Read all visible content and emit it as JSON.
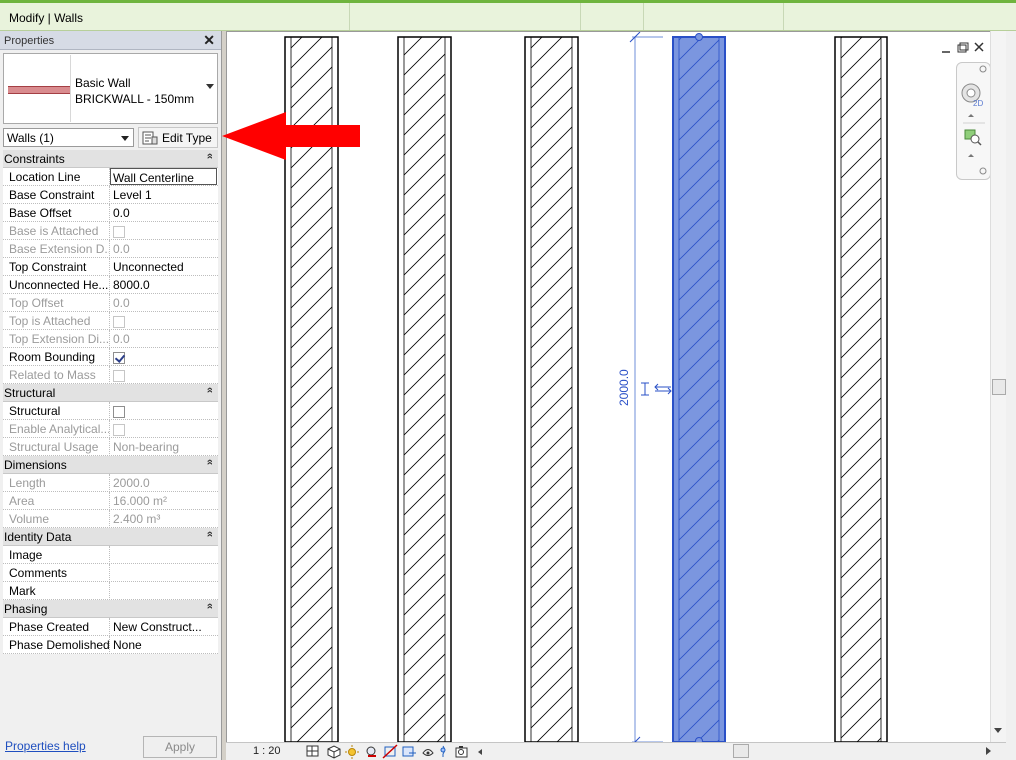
{
  "context_bar": {
    "title": "Modify | Walls"
  },
  "properties": {
    "header": "Properties",
    "close_glyph": "✕",
    "type_selector": {
      "family": "Basic Wall",
      "type": "BRICKWALL - 150mm",
      "swatch_color": "#d98c8f"
    },
    "filter": {
      "value": "Walls (1)"
    },
    "edit_type_label": "Edit Type",
    "collapse_glyph": "»",
    "groups": [
      {
        "name": "Constraints",
        "rows": [
          {
            "key": "Location Line",
            "value": "Wall Centerline",
            "editing": true
          },
          {
            "key": "Base Constraint",
            "value": "Level 1"
          },
          {
            "key": "Base Offset",
            "value": "0.0"
          },
          {
            "key": "Base is Attached",
            "checkbox": false,
            "disabled": true
          },
          {
            "key": "Base Extension D...",
            "value": "0.0",
            "disabled": true
          },
          {
            "key": "Top Constraint",
            "value": "Unconnected"
          },
          {
            "key": "Unconnected He...",
            "value": "8000.0"
          },
          {
            "key": "Top Offset",
            "value": "0.0",
            "disabled": true
          },
          {
            "key": "Top is Attached",
            "checkbox": false,
            "disabled": true
          },
          {
            "key": "Top Extension Di...",
            "value": "0.0",
            "disabled": true
          },
          {
            "key": "Room Bounding",
            "checkbox": true
          },
          {
            "key": "Related to Mass",
            "checkbox": false,
            "disabled": true
          }
        ]
      },
      {
        "name": "Structural",
        "rows": [
          {
            "key": "Structural",
            "checkbox": false
          },
          {
            "key": "Enable Analytical...",
            "checkbox": false,
            "disabled": true
          },
          {
            "key": "Structural Usage",
            "value": "Non-bearing",
            "disabled": true
          }
        ]
      },
      {
        "name": "Dimensions",
        "rows": [
          {
            "key": "Length",
            "value": "2000.0",
            "disabled": true
          },
          {
            "key": "Area",
            "value": "16.000 m²",
            "disabled": true
          },
          {
            "key": "Volume",
            "value": "2.400 m³",
            "disabled": true
          }
        ]
      },
      {
        "name": "Identity Data",
        "rows": [
          {
            "key": "Image",
            "value": ""
          },
          {
            "key": "Comments",
            "value": ""
          },
          {
            "key": "Mark",
            "value": ""
          }
        ]
      },
      {
        "name": "Phasing",
        "rows": [
          {
            "key": "Phase Created",
            "value": "New Construct..."
          },
          {
            "key": "Phase Demolished",
            "value": "None"
          }
        ]
      }
    ],
    "help_link": "Properties help",
    "apply_label": "Apply"
  },
  "canvas": {
    "dimension_label": "2000.0",
    "selection_color": "#7b96df",
    "nav_wheel_label": "2D"
  },
  "status_bar": {
    "scale": "1 : 20"
  },
  "colors": {
    "accent_green": "#6fb43e",
    "selection_blue": "#2a50c7",
    "annotation_red": "#ff0000"
  }
}
